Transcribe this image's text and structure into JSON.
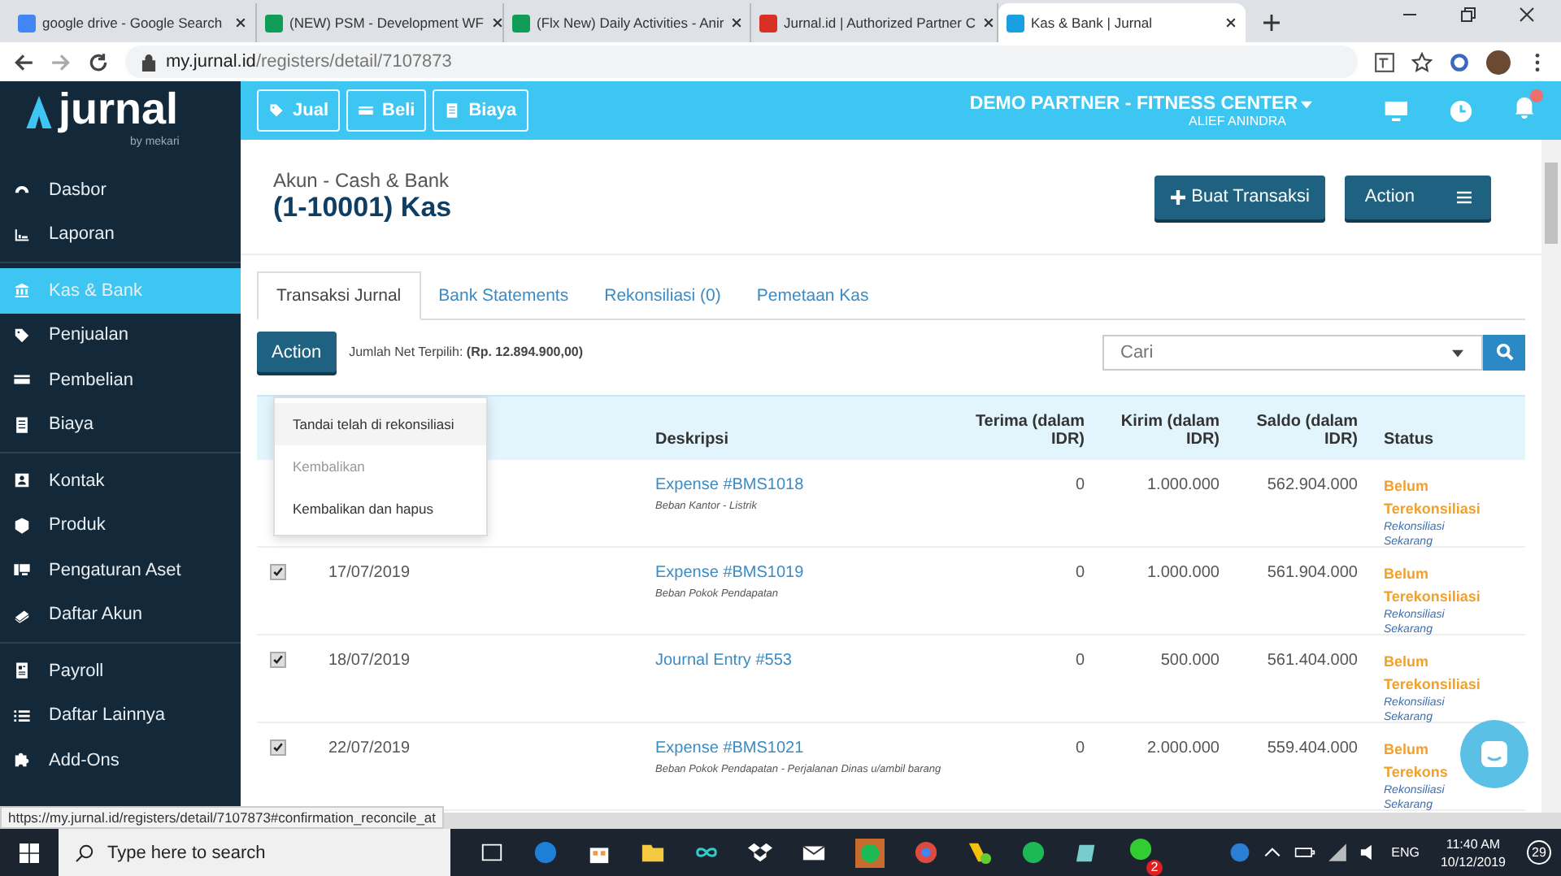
{
  "browser": {
    "tabs": [
      {
        "title": "google drive - Google Search",
        "selected": false
      },
      {
        "title": "(NEW) PSM - Development WF",
        "selected": false
      },
      {
        "title": "(Flx New) Daily Activities - Anir",
        "selected": false
      },
      {
        "title": "Jurnal.id | Authorized Partner C",
        "selected": false
      },
      {
        "title": "Kas & Bank | Jurnal",
        "selected": true
      }
    ],
    "url_host": "my.jurnal.id",
    "url_path": "/registers/detail/7107873"
  },
  "header": {
    "logo": "jurnal",
    "logo_sub": "by mekari",
    "quick_buttons": [
      "Jual",
      "Beli",
      "Biaya"
    ],
    "company": "DEMO PARTNER - FITNESS CENTER",
    "user": "ALIEF ANINDRA",
    "has_notification": true
  },
  "sidebar": {
    "groups": [
      [
        {
          "label": "Dasbor",
          "selected": false
        },
        {
          "label": "Laporan",
          "selected": false
        }
      ],
      [
        {
          "label": "Kas & Bank",
          "selected": true
        },
        {
          "label": "Penjualan",
          "selected": false
        },
        {
          "label": "Pembelian",
          "selected": false
        },
        {
          "label": "Biaya",
          "selected": false
        }
      ],
      [
        {
          "label": "Kontak",
          "selected": false
        },
        {
          "label": "Produk",
          "selected": false
        },
        {
          "label": "Pengaturan Aset",
          "selected": false
        },
        {
          "label": "Daftar Akun",
          "selected": false
        }
      ],
      [
        {
          "label": "Payroll",
          "selected": false
        },
        {
          "label": "Daftar Lainnya",
          "selected": false
        },
        {
          "label": "Add-Ons",
          "selected": false
        }
      ]
    ]
  },
  "page": {
    "breadcrumb": "Akun - Cash & Bank",
    "title": "(1-10001) Kas",
    "create_button": "Buat Transaksi",
    "action_button": "Action",
    "tabs": [
      {
        "label": "Transaksi Jurnal",
        "selected": true
      },
      {
        "label": "Bank Statements",
        "selected": false
      },
      {
        "label": "Rekonsiliasi (0)",
        "selected": false
      },
      {
        "label": "Pemetaan Kas",
        "selected": false
      }
    ],
    "table_action": "Action",
    "net_total": "Jumlah Net Terpilih: **(Rp. 12.894.900,00)**",
    "search": {
      "placeholder": "Cari"
    },
    "menu": [
      {
        "label": "Tandai telah di rekonsiliasi",
        "disabled": false
      },
      {
        "label": "Kembalikan",
        "disabled": true
      },
      {
        "label": "Kembalikan dan hapus",
        "disabled": false
      }
    ],
    "table": {
      "columns": [
        "Deskripsi",
        "Terima (dalam IDR)",
        "Kirim (dalam IDR)",
        "Saldo (dalam IDR)",
        "Status"
      ],
      "rows": [
        {
          "description": "Expense #BMS1018",
          "note": "Beban Kantor - Listrik",
          "terima": "0",
          "kirim": "1.000.000",
          "saldo": "562.904.000",
          "status": "Belum Terekonsiliasi",
          "link": "Rekonsiliasi Sekarang"
        },
        {
          "date": "17/07/2019",
          "description": "Expense #BMS1019",
          "note": "Beban Pokok Pendapatan",
          "terima": "0",
          "kirim": "1.000.000",
          "saldo": "561.904.000",
          "status": "Belum Terekonsiliasi",
          "link": "Rekonsiliasi Sekarang",
          "checked": true
        },
        {
          "date": "18/07/2019",
          "description": "Journal Entry #553",
          "note": "",
          "terima": "0",
          "kirim": "500.000",
          "saldo": "561.404.000",
          "status": "Belum Terekonsiliasi",
          "link": "Rekonsiliasi Sekarang",
          "checked": true
        },
        {
          "date": "22/07/2019",
          "description": "Expense #BMS1021",
          "note": "Beban Pokok Pendapatan - Perjalanan Dinas u/ambil barang",
          "terima": "0",
          "kirim": "2.000.000",
          "saldo": "559.404.000",
          "status": "Belum Terekons",
          "link": "Rekonsiliasi Sekarang",
          "checked": true
        }
      ]
    }
  },
  "status_url": "https://my.jurnal.id/registers/detail/7107873#confirmation_reconcile_at",
  "taskbar": {
    "search_placeholder": "Type here to search",
    "whatsapp_badge": "2",
    "language": "ENG",
    "time": "11:40 AM",
    "date": "10/12/2019",
    "notifications": "29"
  }
}
